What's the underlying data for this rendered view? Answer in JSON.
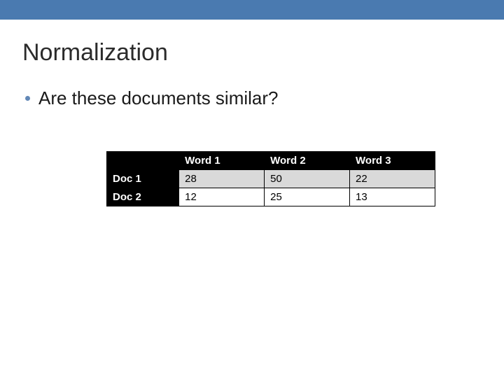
{
  "title": "Normalization",
  "bullet": "Are these documents similar?",
  "table": {
    "columns": [
      "Word 1",
      "Word 2",
      "Word 3"
    ],
    "rows": [
      {
        "label": "Doc 1",
        "cells": [
          "28",
          "50",
          "22"
        ]
      },
      {
        "label": "Doc 2",
        "cells": [
          "12",
          "25",
          "13"
        ]
      }
    ]
  },
  "chart_data": {
    "type": "table",
    "title": "Normalization",
    "columns": [
      "",
      "Word 1",
      "Word 2",
      "Word 3"
    ],
    "rows": [
      [
        "Doc 1",
        28,
        50,
        22
      ],
      [
        "Doc 2",
        12,
        25,
        13
      ]
    ]
  }
}
